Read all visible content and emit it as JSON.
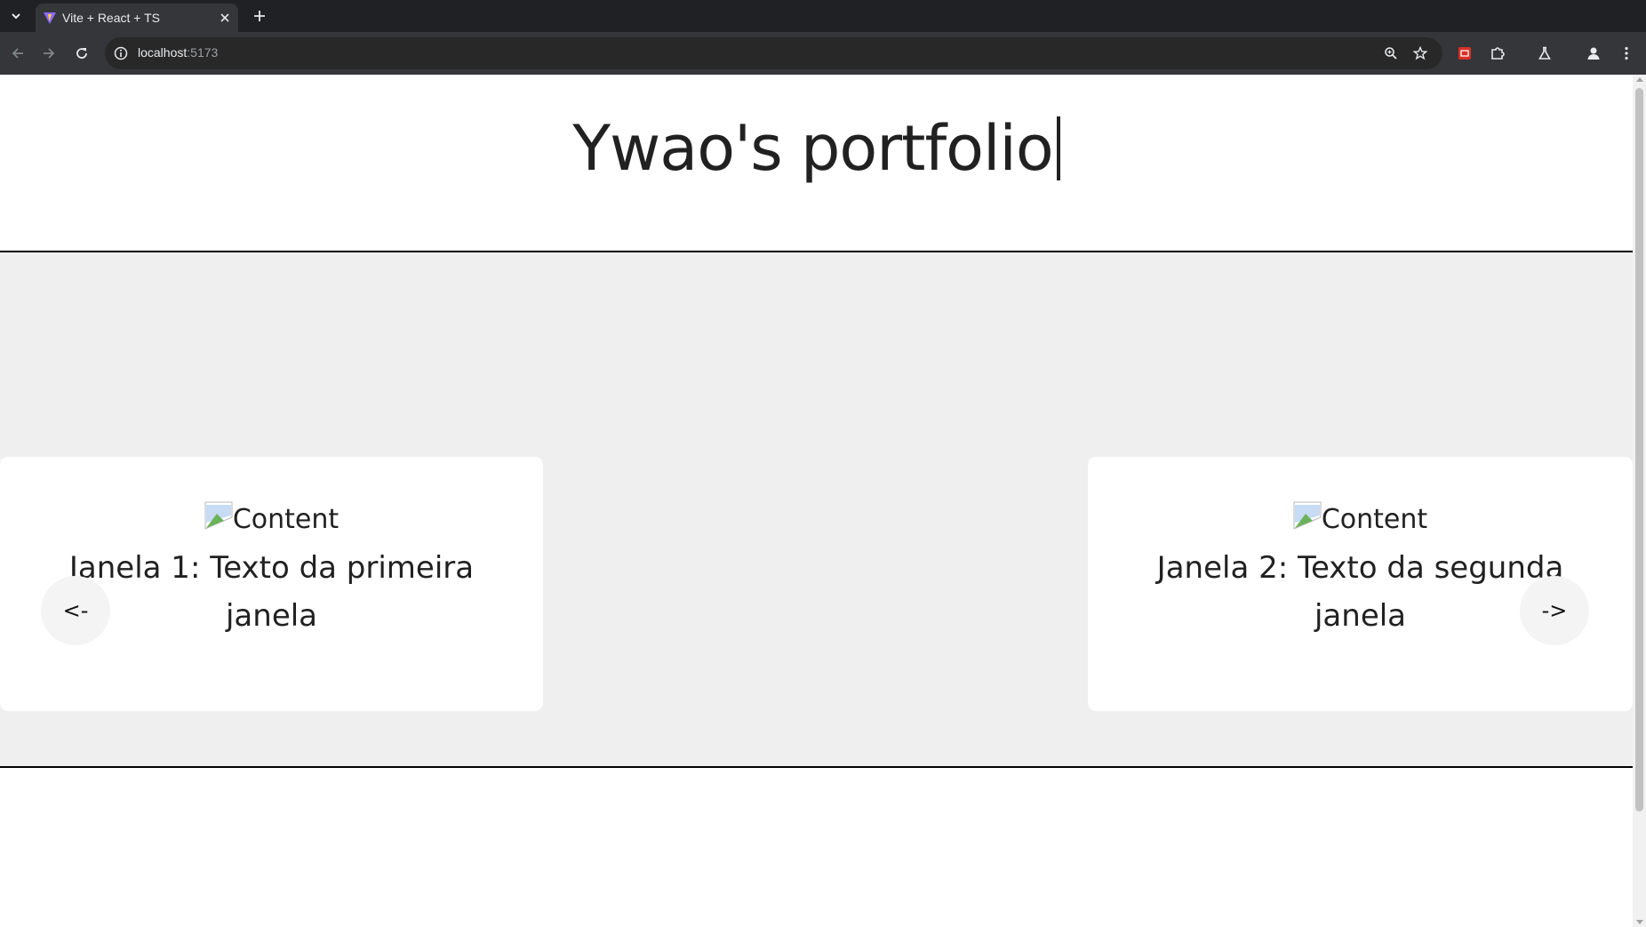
{
  "browser": {
    "tab_title": "Vite + React + TS",
    "url_host": "localhost",
    "url_port": ":5173"
  },
  "page": {
    "title": "Ywao's portfolio",
    "cards": [
      {
        "image_alt": "Content",
        "text": "Janela 1: Texto da primeira janela"
      },
      {
        "image_alt": "Content",
        "text": "Janela 2: Texto da segunda janela"
      }
    ],
    "prev_label": "<-",
    "next_label": "->"
  },
  "colors": {
    "chrome_dark": "#202124",
    "toolbar": "#35363a",
    "section_bg": "#efefef",
    "text": "#212121"
  }
}
